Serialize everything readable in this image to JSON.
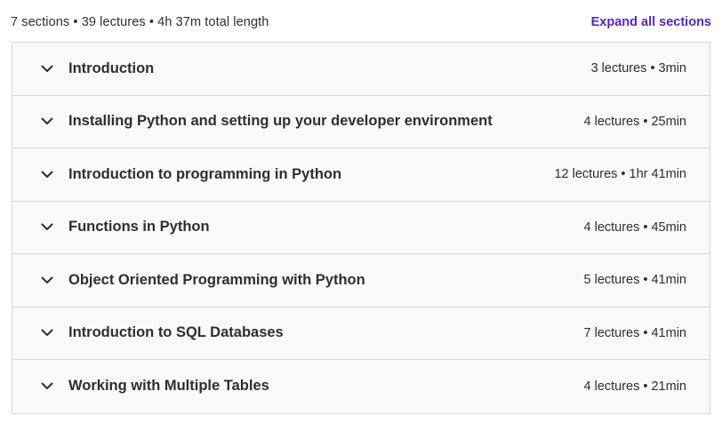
{
  "summary": {
    "text": "7 sections • 39 lectures • 4h 37m total length",
    "expand_label": "Expand all sections"
  },
  "sections": [
    {
      "title": "Introduction",
      "meta": "3 lectures • 3min"
    },
    {
      "title": "Installing Python and setting up your developer environment",
      "meta": "4 lectures • 25min"
    },
    {
      "title": "Introduction to programming in Python",
      "meta": "12 lectures • 1hr 41min"
    },
    {
      "title": "Functions in Python",
      "meta": "4 lectures • 45min"
    },
    {
      "title": "Object Oriented Programming with Python",
      "meta": "5 lectures • 41min"
    },
    {
      "title": "Introduction to SQL Databases",
      "meta": "7 lectures • 41min"
    },
    {
      "title": "Working with Multiple Tables",
      "meta": "4 lectures • 21min"
    }
  ],
  "icons": {
    "section_toggle": "chevron-down-icon"
  },
  "colors": {
    "accent": "#5624d0",
    "text": "#2d2f31",
    "section_bg": "#f7f9fa",
    "border": "#d1d7dc"
  }
}
